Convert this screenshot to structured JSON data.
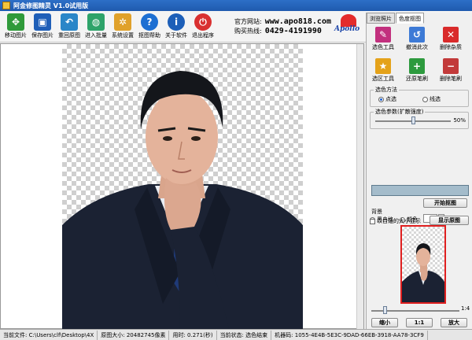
{
  "window": {
    "title": "阿金修图精灵 V1.0试用版"
  },
  "toolbar": {
    "buttons": [
      {
        "label": "移动图片",
        "icon": "move-image-icon",
        "color": "#2f9a3a"
      },
      {
        "label": "保存图片",
        "icon": "save-disk-icon",
        "color": "#1f5fb8"
      },
      {
        "label": "重回原图",
        "icon": "restore-arrow-icon",
        "color": "#2a86c8"
      },
      {
        "label": "进入批量",
        "icon": "batch-globe-icon",
        "color": "#2ea36a"
      },
      {
        "label": "系统设置",
        "icon": "gear-icon",
        "color": "#e0a12a"
      },
      {
        "label": "抠图帮助",
        "icon": "help-icon",
        "color": "#1d6fd2"
      },
      {
        "label": "关于软件",
        "icon": "info-icon",
        "color": "#1d5fb8"
      },
      {
        "label": "退出程序",
        "icon": "power-icon",
        "color": "#d93030"
      }
    ]
  },
  "site": {
    "website_label": "官方网站:",
    "website": "www.apo818.com",
    "hotline_label": "购买热线:",
    "hotline": "0429-4191990",
    "logo_text": "Apollo"
  },
  "tabs": [
    {
      "label": "浏览照片",
      "active": false
    },
    {
      "label": "色度抠图",
      "active": true
    }
  ],
  "tools": [
    {
      "label": "选色工具",
      "icon": "color-picker-icon",
      "color": "#c2307e"
    },
    {
      "label": "撤消此次",
      "icon": "undo-icon",
      "color": "#3d7ad6"
    },
    {
      "label": "删除杂质",
      "icon": "delete-x-icon",
      "color": "#d92a2a"
    },
    {
      "label": "选区工具",
      "icon": "star-select-icon",
      "color": "#e4a21a"
    },
    {
      "label": "还原笔刷",
      "icon": "restore-brush-icon",
      "color": "#2d9a3e"
    },
    {
      "label": "删除笔刷",
      "icon": "delete-brush-icon",
      "color": "#c23a3a"
    }
  ],
  "color_method": {
    "label": "选色方法",
    "options": [
      "点选",
      "线选"
    ],
    "selected": 0
  },
  "color_param": {
    "label": "选色参数(扩散强度)",
    "value": "50%",
    "level": 0.5
  },
  "start_button": "开始抠图",
  "background": {
    "label": "背景",
    "options": [
      "黑白格",
      "颜色",
      "蒙板"
    ],
    "selected": 0,
    "fit_label": "以合适的大小显示",
    "show_original": "显示原图"
  },
  "zoom": {
    "max": "1:4",
    "zoom_out": "缩小",
    "ratio": "1:1",
    "zoom_in": "放大",
    "level": 0.15
  },
  "status": {
    "file": "当前文件: C:\\Users\\clf\\Desktop\\4X",
    "size": "原图大小: 20482745像素",
    "time": "用时: 0.271(秒)",
    "state": "当前状态: 选色结束",
    "machine": "机器码: 1055-4E4B-5E3C-9DAD-66EB-3918-AA78-3CF9"
  },
  "colors": {
    "accent": "#1f5aae",
    "preview_border": "#e01f1f",
    "suit": "#1b2233"
  }
}
